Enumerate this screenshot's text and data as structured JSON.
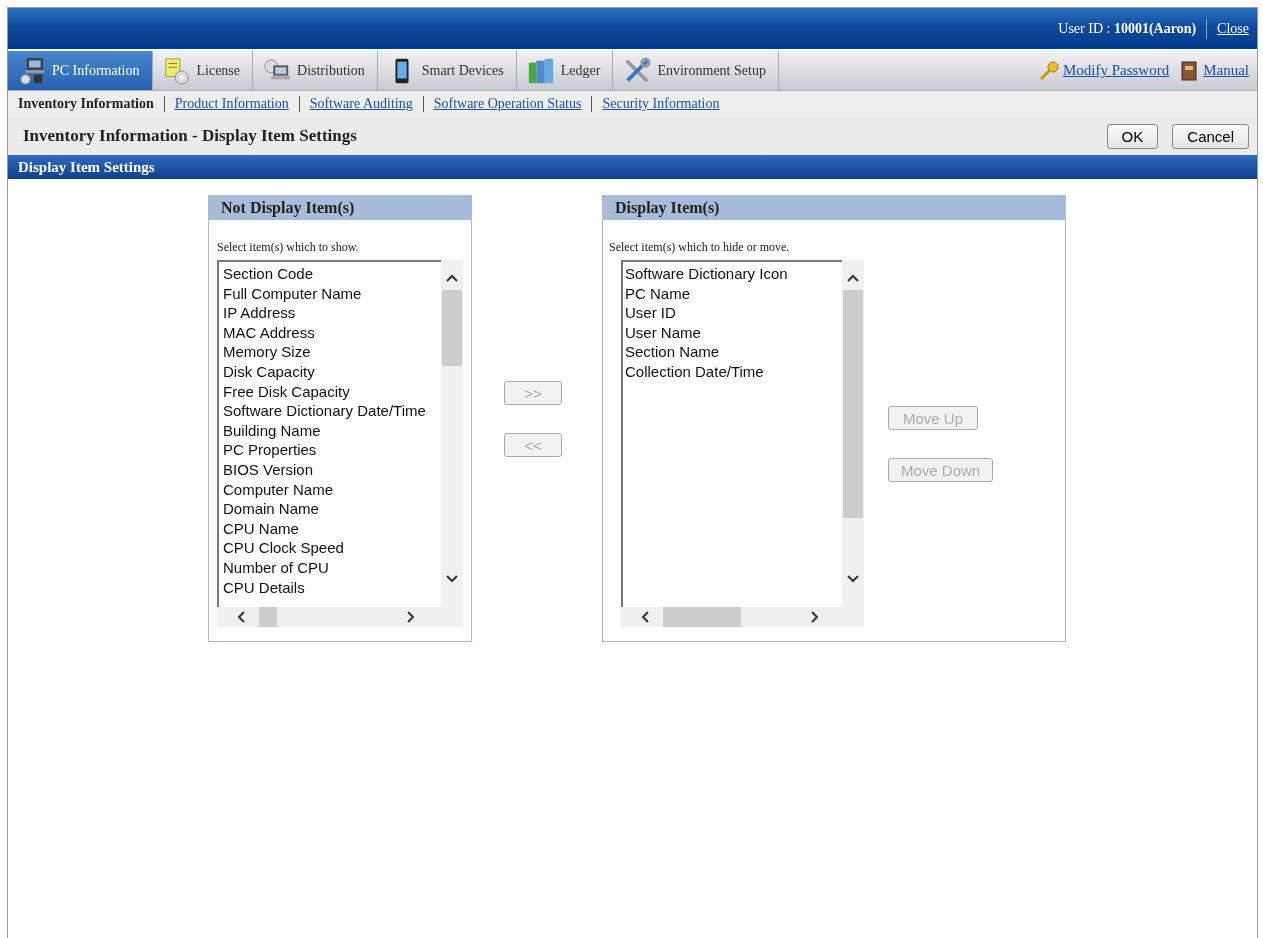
{
  "header": {
    "user_label": "User ID : ",
    "user_value": "10001(Aaron)",
    "close_link": "Close"
  },
  "tabs": [
    {
      "label": "PC Information",
      "selected": true
    },
    {
      "label": "License",
      "selected": false
    },
    {
      "label": "Distribution",
      "selected": false
    },
    {
      "label": "Smart Devices",
      "selected": false
    },
    {
      "label": "Ledger",
      "selected": false
    },
    {
      "label": "Environment Setup",
      "selected": false
    }
  ],
  "header_links": [
    {
      "label": "Modify Password"
    },
    {
      "label": "Manual"
    }
  ],
  "subnav": [
    {
      "label": "Inventory Information",
      "selected": true
    },
    {
      "label": "Product Information",
      "selected": false
    },
    {
      "label": "Software Auditing",
      "selected": false
    },
    {
      "label": "Software Operation Status",
      "selected": false
    },
    {
      "label": "Security Information",
      "selected": false
    }
  ],
  "page_title": "Inventory Information - Display Item Settings",
  "actions": [
    "OK",
    "Cancel"
  ],
  "section_title": "Display Item Settings",
  "not_display_panel": {
    "title": "Not Display Item(s)",
    "hint": "Select item(s) which to show.",
    "items": [
      "Section Code",
      "Full Computer Name",
      "IP Address",
      "MAC Address",
      "Memory Size",
      "Disk Capacity",
      "Free Disk Capacity",
      "Software Dictionary Date/Time",
      "Building Name",
      "PC Properties",
      "BIOS Version",
      "Computer Name",
      "Domain Name",
      "CPU Name",
      "CPU Clock Speed",
      "Number of CPU",
      "CPU Details"
    ]
  },
  "transfer_buttons": [
    {
      "label": ">>",
      "disabled": true
    },
    {
      "label": "<<",
      "disabled": true
    }
  ],
  "display_panel": {
    "title": "Display Item(s)",
    "hint": "Select item(s) which to hide or move.",
    "items": [
      "Software Dictionary Icon",
      "PC Name",
      "User ID",
      "User Name",
      "Section Name",
      "Collection Date/Time"
    ]
  },
  "order_buttons": [
    {
      "label": "Move Up",
      "disabled": true
    },
    {
      "label": "Move Down",
      "disabled": true
    }
  ]
}
